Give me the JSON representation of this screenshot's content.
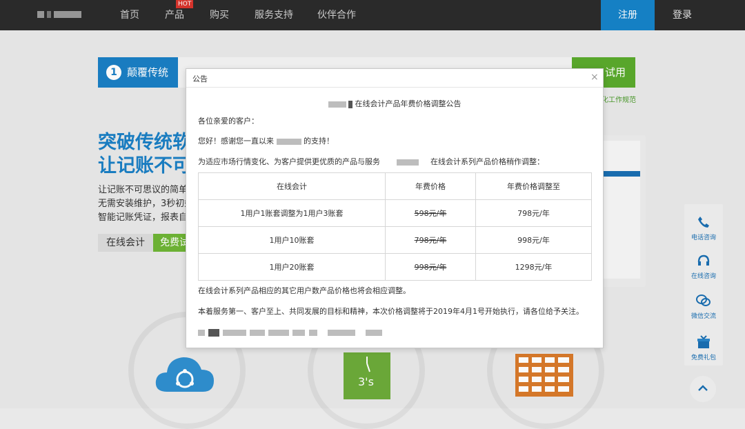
{
  "nav": {
    "items": [
      "首页",
      "产品",
      "购买",
      "服务支持",
      "伙伴合作"
    ],
    "hot_badge": "HOT",
    "register": "注册",
    "login": "登录"
  },
  "background": {
    "step_active": {
      "number": "1",
      "label": "颠覆传统"
    },
    "trial_button": "试用",
    "side_note": "化工作规范",
    "hero_title_lines": [
      "突破传统软",
      "让记账不可"
    ],
    "hero_desc_lines": [
      "让记账不可思议的简单",
      "无需安装维护，3秒初始",
      "智能记账凭证，报表自"
    ],
    "tag_online": "在线会计",
    "tag_free": "免费试"
  },
  "sidebar": {
    "items": [
      {
        "label": "电话咨询",
        "icon": "phone-icon"
      },
      {
        "label": "在线咨询",
        "icon": "headset-icon"
      },
      {
        "label": "微信交流",
        "icon": "wechat-icon"
      },
      {
        "label": "免费礼包",
        "icon": "gift-icon"
      }
    ],
    "up_icon": "chevron-up-icon"
  },
  "dialog": {
    "title": "公告",
    "close": "×",
    "announcement_title": "在线会计产品年费价格调整公告",
    "greeting": "各位亲爱的客户：",
    "thanks_prefix": "您好！感谢您一直以来",
    "thanks_suffix": "的支持！",
    "intro_prefix": "为适应市场行情变化、为客户提供更优质的产品与服务",
    "intro_suffix": "在线会计系列产品价格稍作调整：",
    "table": {
      "headers": [
        "在线会计",
        "年费价格",
        "年费价格调整至"
      ],
      "rows": [
        {
          "name": "1用户1账套调整为1用户3账套",
          "old": "598元/年",
          "new": "798元/年"
        },
        {
          "name": "1用户10账套",
          "old": "798元/年",
          "new": "998元/年"
        },
        {
          "name": "1用户20账套",
          "old": "998元/年",
          "new": "1298元/年"
        }
      ]
    },
    "note": "在线会计系列产品相应的其它用户数产品价格也将会相应调整。",
    "closing": "本着服务第一、客户至上、共同发展的目标和精神，本次价格调整将于2019年4月1号开始执行，请各位给予关注。"
  },
  "colors": {
    "topbar": "#2b2b2b",
    "register_bg": "#1683c8",
    "accent_blue": "#1a7fc4",
    "accent_green": "#5aaa2c",
    "hot_badge": "#d9352c"
  }
}
